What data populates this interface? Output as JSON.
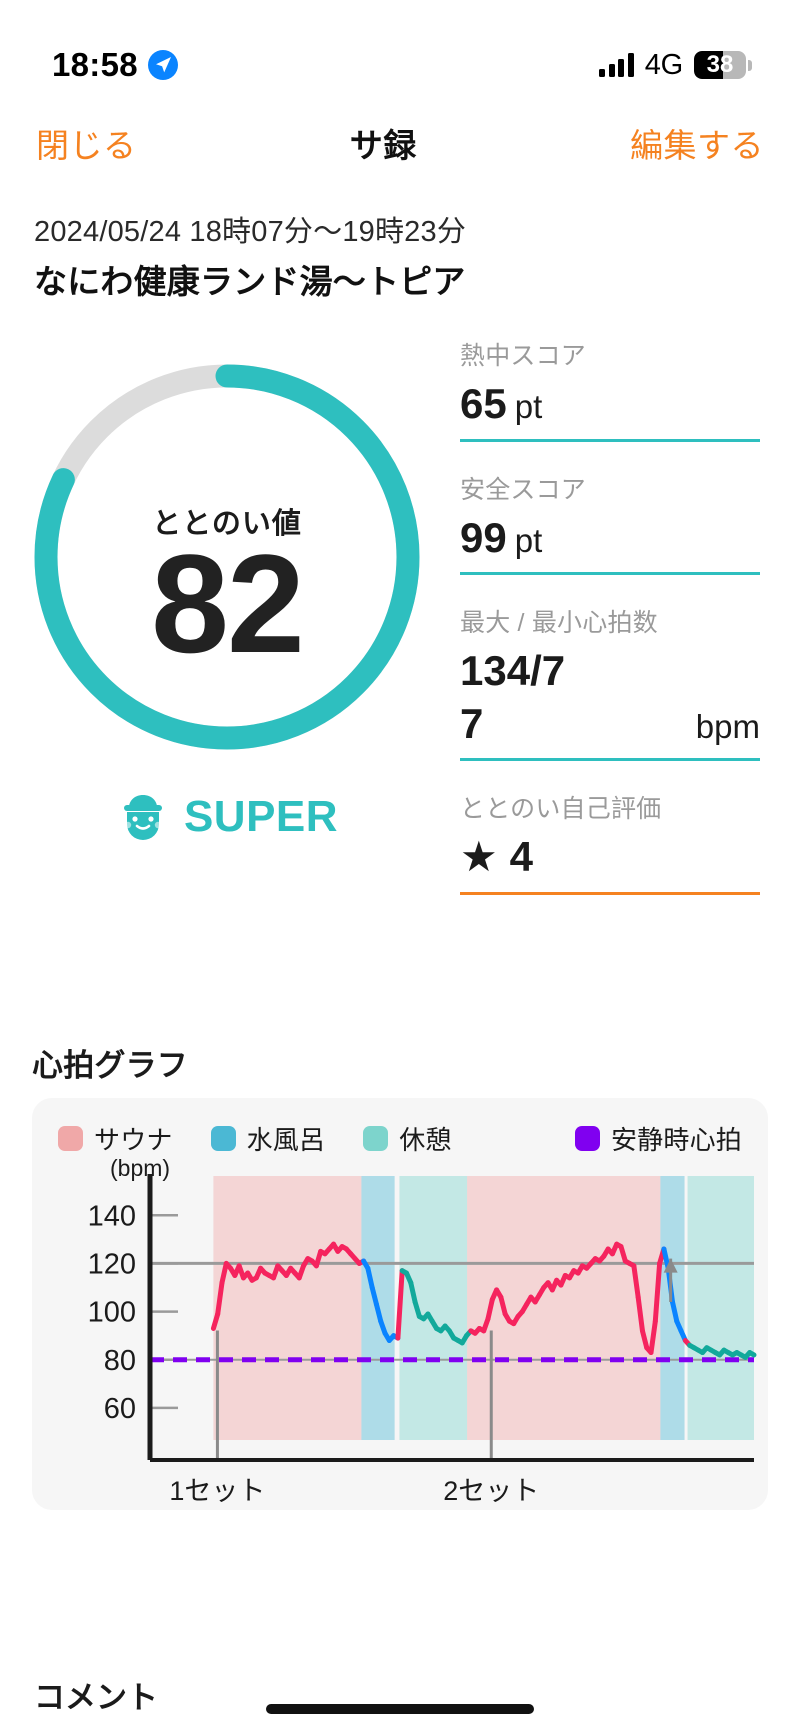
{
  "status_bar": {
    "time": "18:58",
    "location_icon": "location-arrow-icon",
    "signal_icon": "signal-bars-icon",
    "network": "4G",
    "battery_percent": "38",
    "battery_level": 38
  },
  "nav": {
    "close_label": "閉じる",
    "title": "サ録",
    "edit_label": "編集する"
  },
  "header": {
    "datetime": "2024/05/24 18時07分〜19時23分",
    "venue": "なにわ健康ランド湯〜トピア"
  },
  "score_ring": {
    "label": "ととのい値",
    "value": "82",
    "value_number": 82,
    "max": 100,
    "ring_color": "#2EBFBF",
    "track_color": "#DCDCDC",
    "badge_label": "SUPER",
    "badge_icon": "sauna-face-icon"
  },
  "stats": [
    {
      "label": "熱中スコア",
      "value": "65",
      "unit": "pt",
      "rule_color": "#2EBFBF"
    },
    {
      "label": "安全スコア",
      "value": "99",
      "unit": "pt",
      "rule_color": "#2EBFBF"
    },
    {
      "label": "最大 / 最小心拍数",
      "value_line1": "134/7",
      "value_line2": "7",
      "unit": "bpm",
      "rule_color": "#2EBFBF"
    },
    {
      "label": "ととのい自己評価",
      "star": "★",
      "value": "4",
      "rule_color": "#F58220"
    }
  ],
  "chart_section": {
    "heading": "心拍グラフ",
    "legend": [
      {
        "label": "サウナ",
        "color": "#F0A8A8"
      },
      {
        "label": "水風呂",
        "color": "#4BB8D4"
      },
      {
        "label": "休憩",
        "color": "#7DD4CC"
      },
      {
        "label": "安静時心拍",
        "color": "#8000F0"
      }
    ]
  },
  "footer": {
    "comment_heading": "コメント"
  },
  "chart_data": {
    "type": "line",
    "title": "心拍グラフ",
    "ylabel": "(bpm)",
    "xlabel": "",
    "ylim": [
      50,
      148
    ],
    "yticks": [
      60,
      80,
      100,
      120,
      140
    ],
    "ytick_labels": [
      "60",
      "80",
      "100",
      "120",
      "140"
    ],
    "grid": "gridline at 120 and dashed resting line at 80",
    "reference_lines": [
      {
        "value": 120,
        "color": "#9a9a9a",
        "style": "solid"
      },
      {
        "value": 80,
        "color": "#8000F0",
        "style": "dashed",
        "name": "安静時心拍"
      }
    ],
    "xticks": [
      0.115,
      0.565
    ],
    "xtick_labels": [
      "1セット",
      "2セット"
    ],
    "phase_bands": [
      {
        "name": "サウナ",
        "color": "#F0A8A8",
        "x0": 0.105,
        "x1": 0.35
      },
      {
        "name": "水風呂",
        "color": "#4BB8D4",
        "x0": 0.35,
        "x1": 0.405
      },
      {
        "name": "休憩",
        "color": "#7DD4CC",
        "x0": 0.413,
        "x1": 0.525
      },
      {
        "name": "サウナ",
        "color": "#F0A8A8",
        "x0": 0.525,
        "x1": 0.845
      },
      {
        "name": "水風呂",
        "color": "#4BB8D4",
        "x0": 0.845,
        "x1": 0.885
      },
      {
        "name": "休憩",
        "color": "#7DD4CC",
        "x0": 0.89,
        "x1": 1.0
      }
    ],
    "series": [
      {
        "name": "心拍数",
        "unit": "bpm",
        "segment_colors": {
          "サウナ": "#F5245E",
          "水風呂": "#0A84FF",
          "休憩": "#12A99B"
        },
        "values": [
          93,
          99,
          112,
          120,
          118,
          115,
          119,
          114,
          116,
          113,
          114,
          118,
          116,
          115,
          114,
          119,
          117,
          115,
          118,
          116,
          114,
          119,
          122,
          121,
          119,
          125,
          124,
          126,
          128,
          125,
          127,
          126,
          124,
          122,
          120,
          121,
          118,
          110,
          103,
          96,
          91,
          88,
          90,
          89,
          117,
          116,
          112,
          104,
          98,
          97,
          99,
          96,
          93,
          92,
          94,
          92,
          89,
          88,
          87,
          90,
          92,
          91,
          93,
          92,
          97,
          105,
          109,
          106,
          99,
          96,
          95,
          98,
          100,
          103,
          106,
          104,
          107,
          110,
          112,
          109,
          113,
          111,
          115,
          114,
          117,
          116,
          119,
          118,
          120,
          122,
          121,
          123,
          126,
          124,
          128,
          127,
          121,
          120,
          119,
          106,
          92,
          85,
          83,
          96,
          120,
          126,
          118,
          104,
          96,
          92,
          88,
          86,
          85,
          84,
          83,
          85,
          84,
          83,
          82,
          84,
          83,
          82,
          83,
          82,
          81,
          83,
          82
        ],
        "min": 77,
        "max": 134
      }
    ],
    "summary": {
      "max_hr": 134,
      "min_hr": 77,
      "resting_hr": 80
    }
  }
}
